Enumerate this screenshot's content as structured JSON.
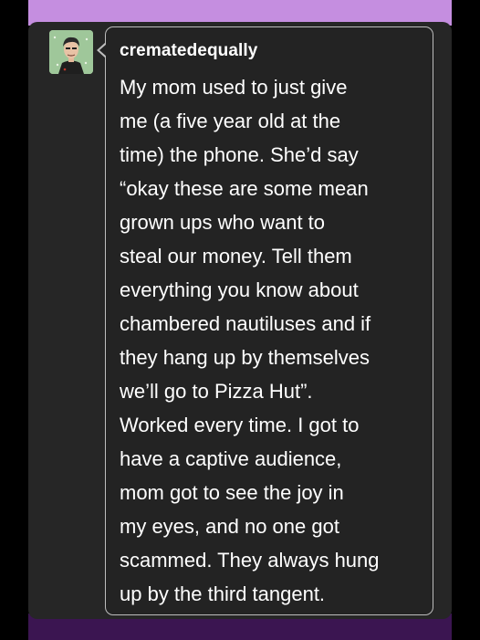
{
  "colors": {
    "top_band": "#c58ee0",
    "bottom_band": "#3b1551",
    "card": "#262626",
    "bubble_border": "#bdbdbd",
    "text": "#ffffff"
  },
  "post": {
    "avatar_icon": "avatar-icon",
    "username": "crematedequally",
    "lines": [
      "My mom used to just give",
      "me (a five year old at the",
      "time) the phone. She’d say",
      "“okay these are some mean",
      "grown ups who want to",
      "steal our money. Tell them",
      "everything you know about",
      "chambered nautiluses and if",
      "they hang up by themselves",
      "we’ll go to Pizza Hut”.",
      "Worked every time. I got to",
      "have a captive audience,",
      "mom got to see the joy in",
      "my eyes, and no one got",
      "scammed. They always hung",
      "up by the third tangent."
    ]
  }
}
